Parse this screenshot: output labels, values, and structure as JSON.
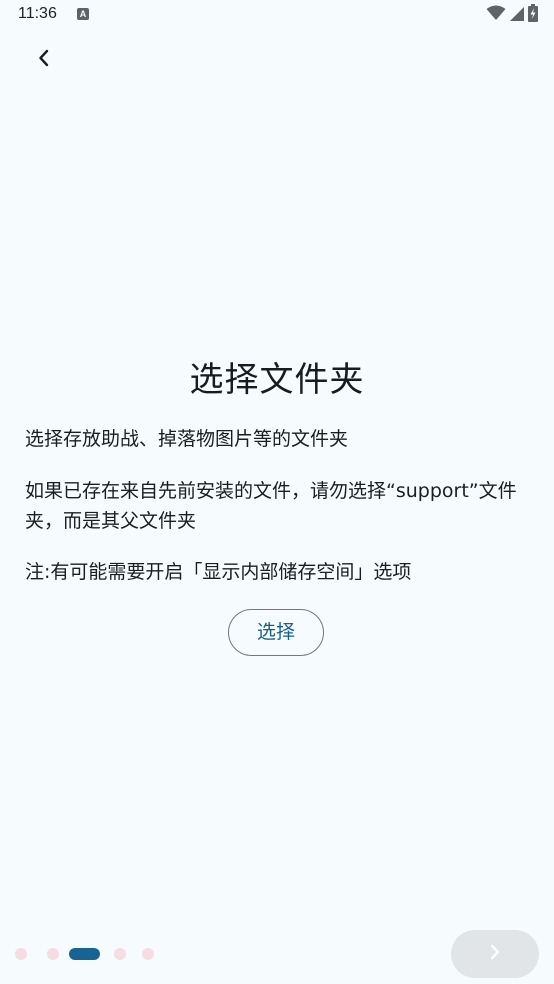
{
  "status_bar": {
    "time": "11:36",
    "notification_icon_letter": "A",
    "icons": [
      "wifi-icon",
      "signal-icon",
      "battery-charging-icon"
    ]
  },
  "header": {
    "back_icon": "chevron-left-icon"
  },
  "main": {
    "title": "选择文件夹",
    "paragraphs": [
      "选择存放助战、掉落物图片等的文件夹",
      "如果已存在来自先前安装的文件，请勿选择“support”文件夹，而是其父文件夹",
      "注:有可能需要开启「显示内部储存空间」选项"
    ],
    "select_button_label": "选择"
  },
  "footer": {
    "page_indicator": {
      "total": 5,
      "active_index": 2
    },
    "next_icon": "chevron-right-icon"
  },
  "colors": {
    "background": "#f6fbfe",
    "accent": "#176492",
    "inactive_dot": "#f5dde3",
    "next_button_bg": "#e2e5e8"
  }
}
